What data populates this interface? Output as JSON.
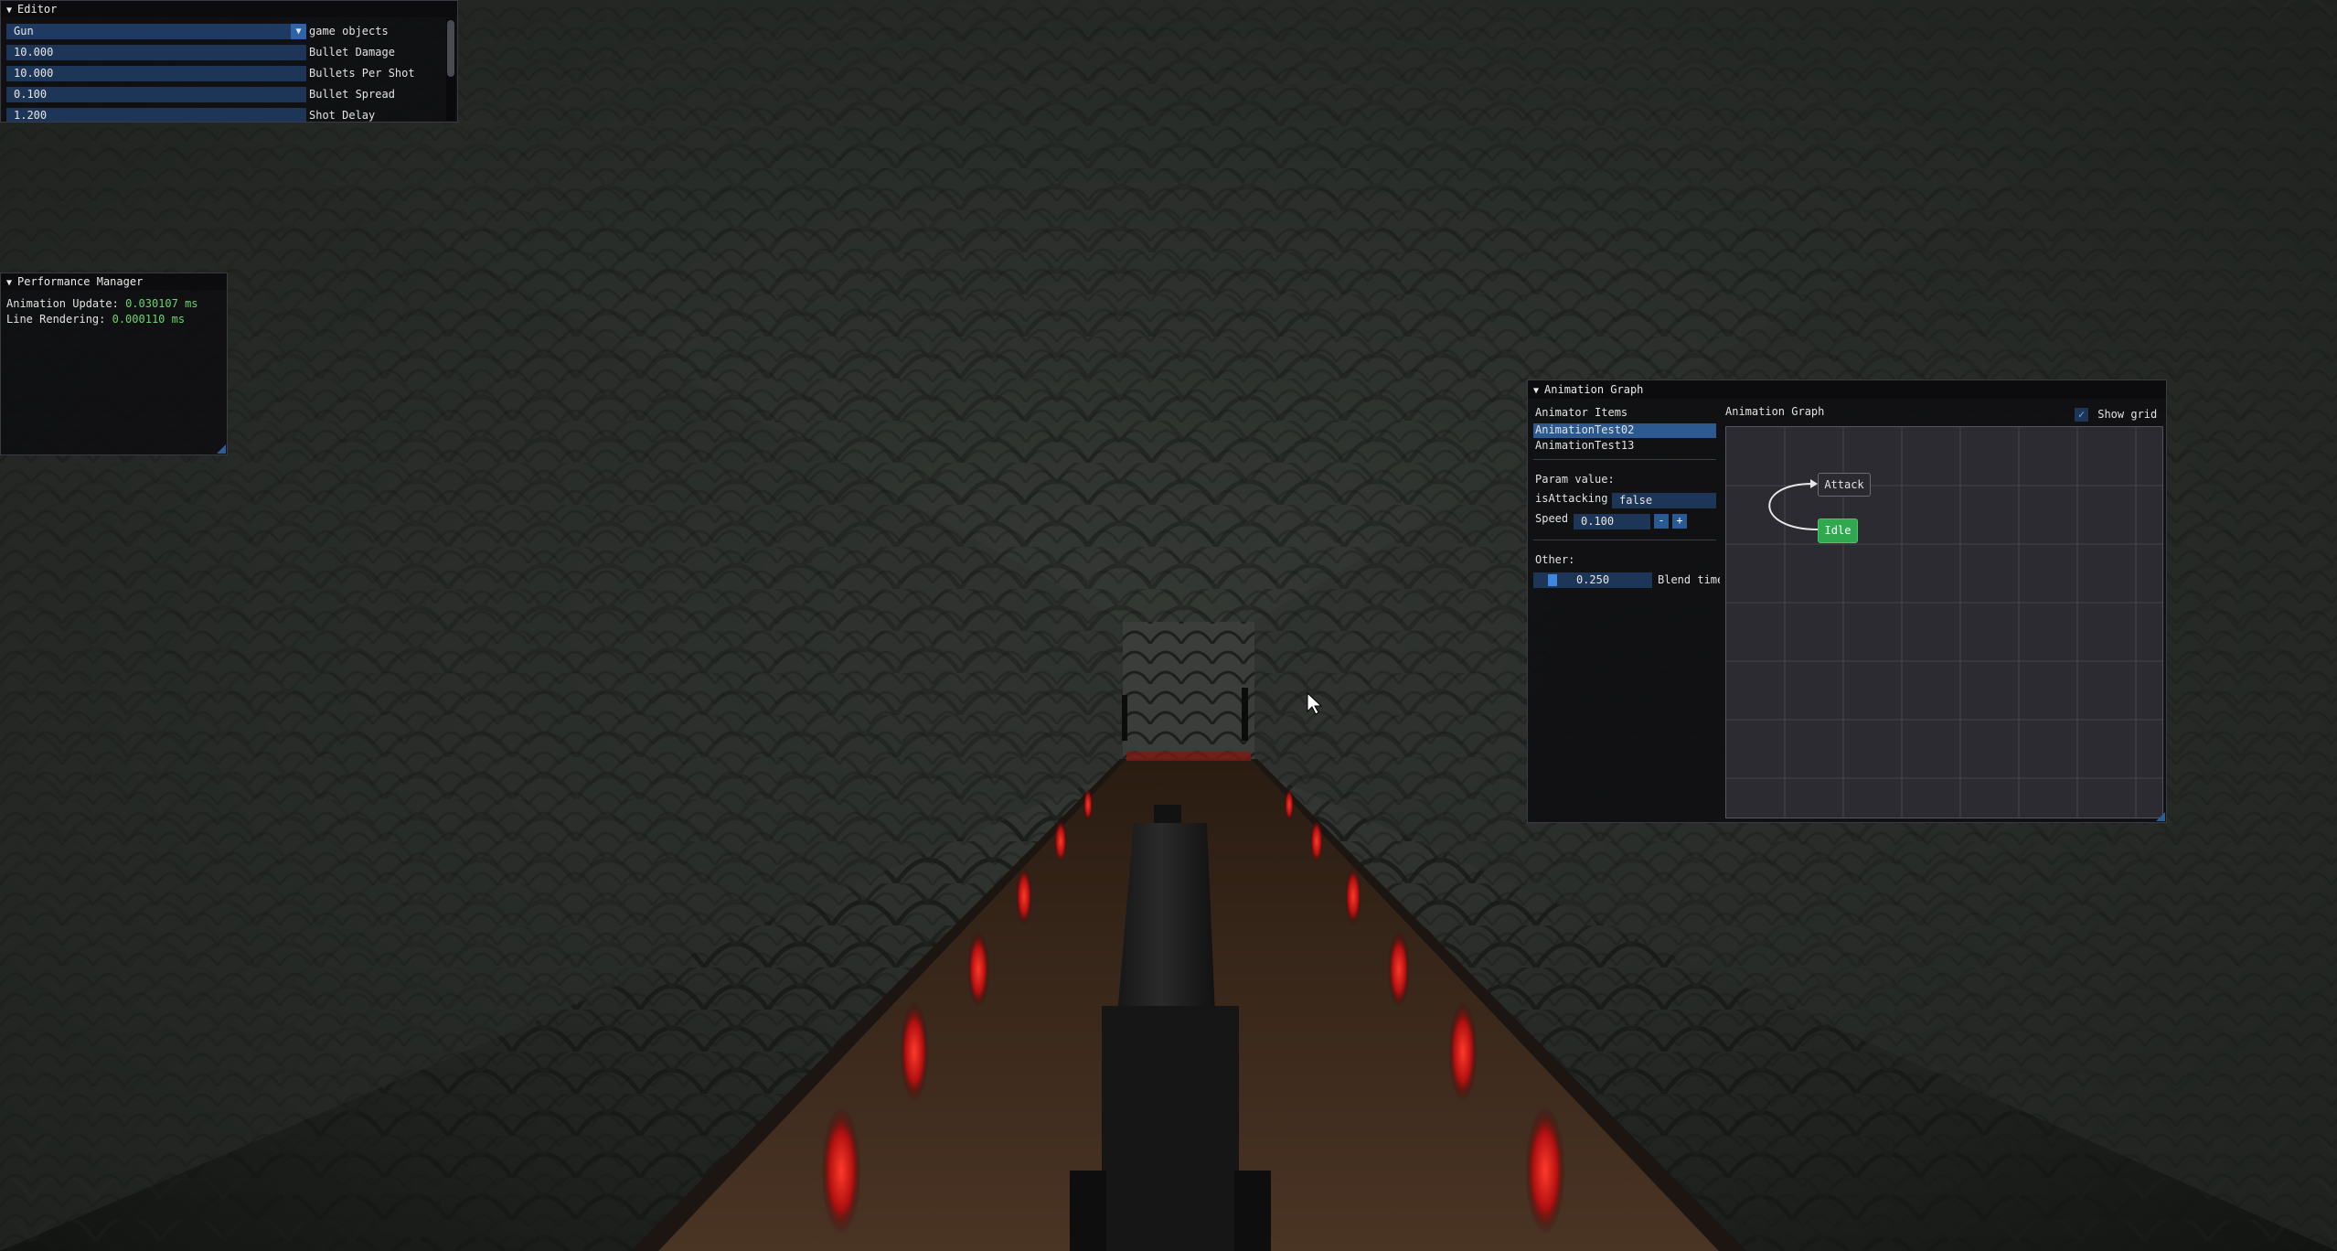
{
  "editor": {
    "title": "Editor",
    "combo": {
      "value": "Gun",
      "label": "game objects"
    },
    "fields": [
      {
        "value": "10.000",
        "label": "Bullet Damage"
      },
      {
        "value": "10.000",
        "label": "Bullets Per Shot"
      },
      {
        "value": "0.100",
        "label": "Bullet Spread"
      },
      {
        "value": "1.200",
        "label": "Shot Delay"
      }
    ]
  },
  "performance": {
    "title": "Performance Manager",
    "lines": [
      {
        "label": "Animation Update:",
        "value": "0.030107 ms"
      },
      {
        "label": "Line Rendering:",
        "value": "0.000110 ms"
      }
    ]
  },
  "anim_window": {
    "title": "Animation Graph",
    "left": {
      "header": "Animator Items",
      "items": [
        "AnimationTest02",
        "AnimationTest13"
      ],
      "selected_index": 0,
      "param_header": "Param value:",
      "is_attacking": {
        "label": "isAttacking",
        "value": "false"
      },
      "speed": {
        "label": "Speed",
        "value": "0.100",
        "minus": "-",
        "plus": "+"
      },
      "other_header": "Other:",
      "blend": {
        "value": "0.250",
        "label": "Blend time"
      }
    },
    "graph": {
      "header": "Animation Graph",
      "show_grid_label": "Show grid",
      "show_grid_checked": true,
      "nodes": [
        {
          "label": "Attack",
          "active": false
        },
        {
          "label": "Idle",
          "active": true
        }
      ],
      "colors": {
        "active_node": "#2fa84f",
        "node": "#2a2a30",
        "canvas": "#2b2b31",
        "grid": "#44444c"
      }
    }
  }
}
